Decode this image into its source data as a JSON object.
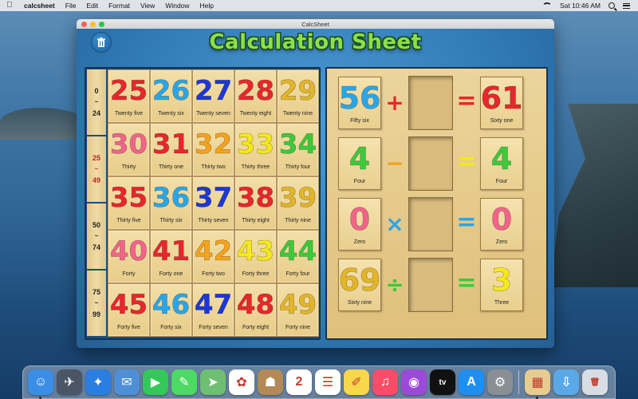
{
  "menubar": {
    "app_name": "calcsheet",
    "menus": [
      "File",
      "Edit",
      "Format",
      "View",
      "Window",
      "Help"
    ],
    "clock": "Sat 10:46 AM"
  },
  "window": {
    "title": "CalcSheet",
    "app_title": "Calculation Sheet"
  },
  "ranges": [
    {
      "from": "0",
      "tilde": "~",
      "to": "24",
      "active": false
    },
    {
      "from": "25",
      "tilde": "~",
      "to": "49",
      "active": true
    },
    {
      "from": "50",
      "tilde": "~",
      "to": "74",
      "active": false
    },
    {
      "from": "75",
      "tilde": "~",
      "to": "99",
      "active": false
    }
  ],
  "tiles": [
    {
      "num": "25",
      "word": "Twenty five",
      "color": "#e8262d"
    },
    {
      "num": "26",
      "word": "Twenty six",
      "color": "#2aa6e8"
    },
    {
      "num": "27",
      "word": "Twenty seven",
      "color": "#1d37d6"
    },
    {
      "num": "28",
      "word": "Twenty eight",
      "color": "#e8262d"
    },
    {
      "num": "29",
      "word": "Twenty nine",
      "color": "#e2b52a"
    },
    {
      "num": "30",
      "word": "Thirty",
      "color": "#f2648a"
    },
    {
      "num": "31",
      "word": "Thirty one",
      "color": "#e8262d"
    },
    {
      "num": "32",
      "word": "Thirty two",
      "color": "#f5a21c"
    },
    {
      "num": "33",
      "word": "Thirty three",
      "color": "#f5e81c"
    },
    {
      "num": "34",
      "word": "Thirty four",
      "color": "#3ec93a"
    },
    {
      "num": "35",
      "word": "Thirty five",
      "color": "#e8262d"
    },
    {
      "num": "36",
      "word": "Thirty six",
      "color": "#2aa6e8"
    },
    {
      "num": "37",
      "word": "Thirty seven",
      "color": "#1d37d6"
    },
    {
      "num": "38",
      "word": "Thirty eight",
      "color": "#e8262d"
    },
    {
      "num": "39",
      "word": "Thirty nine",
      "color": "#e2b52a"
    },
    {
      "num": "40",
      "word": "Forty",
      "color": "#f2648a"
    },
    {
      "num": "41",
      "word": "Forty one",
      "color": "#e8262d"
    },
    {
      "num": "42",
      "word": "Forty two",
      "color": "#f5a21c"
    },
    {
      "num": "43",
      "word": "Forty three",
      "color": "#f5e81c"
    },
    {
      "num": "44",
      "word": "Forty four",
      "color": "#3ec93a"
    },
    {
      "num": "45",
      "word": "Forty five",
      "color": "#e8262d"
    },
    {
      "num": "46",
      "word": "Forty six",
      "color": "#2aa6e8"
    },
    {
      "num": "47",
      "word": "Forty seven",
      "color": "#1d37d6"
    },
    {
      "num": "48",
      "word": "Forty eight",
      "color": "#e8262d"
    },
    {
      "num": "49",
      "word": "Forty nine",
      "color": "#e2b52a"
    }
  ],
  "equations": [
    {
      "left": {
        "num": "56",
        "word": "Fifty six",
        "color": "#2aa6e8"
      },
      "op": "+",
      "op_color": "#e8262d",
      "eq_color": "#e8262d",
      "result": {
        "num": "61",
        "word": "Sixty one",
        "color": "#e8262d"
      }
    },
    {
      "left": {
        "num": "4",
        "word": "Four",
        "color": "#3ec93a"
      },
      "op": "−",
      "op_color": "#f5a21c",
      "eq_color": "#f5e81c",
      "result": {
        "num": "4",
        "word": "Four",
        "color": "#3ec93a"
      }
    },
    {
      "left": {
        "num": "0",
        "word": "Zero",
        "color": "#f2648a"
      },
      "op": "×",
      "op_color": "#2aa6e8",
      "eq_color": "#2aa6e8",
      "result": {
        "num": "0",
        "word": "Zero",
        "color": "#f2648a"
      }
    },
    {
      "left": {
        "num": "69",
        "word": "Sixty nine",
        "color": "#e2b52a"
      },
      "op": "÷",
      "op_color": "#3ec93a",
      "eq_color": "#3ec93a",
      "result": {
        "num": "3",
        "word": "Three",
        "color": "#f5e81c"
      }
    }
  ],
  "dock": [
    {
      "name": "finder-icon",
      "glyph": "☺",
      "bg": "#3a8ee6",
      "running": true
    },
    {
      "name": "launchpad-icon",
      "glyph": "✈",
      "bg": "#4a5566",
      "running": false
    },
    {
      "name": "safari-icon",
      "glyph": "✦",
      "bg": "#2a7de1",
      "running": false
    },
    {
      "name": "mail-icon",
      "glyph": "✉",
      "bg": "#4f8fd6",
      "running": false
    },
    {
      "name": "facetime-icon",
      "glyph": "▶",
      "bg": "#34c759",
      "running": false
    },
    {
      "name": "messages-icon",
      "glyph": "✎",
      "bg": "#4cd964",
      "running": false
    },
    {
      "name": "maps-icon",
      "glyph": "➤",
      "bg": "#6fbf73",
      "running": false
    },
    {
      "name": "photos-icon",
      "glyph": "✿",
      "bg": "#ffffff",
      "running": false
    },
    {
      "name": "contacts-icon",
      "glyph": "☗",
      "bg": "#b38a55",
      "running": false
    },
    {
      "name": "calendar-icon",
      "glyph": "2",
      "bg": "#ffffff",
      "running": false
    },
    {
      "name": "reminders-icon",
      "glyph": "☰",
      "bg": "#ffffff",
      "running": false
    },
    {
      "name": "notes-icon",
      "glyph": "✐",
      "bg": "#f8d84b",
      "running": false
    },
    {
      "name": "music-icon",
      "glyph": "♫",
      "bg": "#f94c68",
      "running": false
    },
    {
      "name": "podcasts-icon",
      "glyph": "◉",
      "bg": "#9b4ad8",
      "running": false
    },
    {
      "name": "tv-icon",
      "glyph": "tv",
      "bg": "#111111",
      "running": false
    },
    {
      "name": "app-store-icon",
      "glyph": "A",
      "bg": "#1f8ef1",
      "running": false
    },
    {
      "name": "system-preferences-icon",
      "glyph": "⚙",
      "bg": "#8a8f96",
      "running": false
    },
    {
      "name": "calcsheet-app-icon",
      "glyph": "▦",
      "bg": "#e7cc8f",
      "running": true
    },
    {
      "name": "downloads-folder-icon",
      "glyph": "⇩",
      "bg": "#5aa9e6",
      "running": false
    },
    {
      "name": "trash-icon",
      "glyph": "🗑",
      "bg": "#d8dde3",
      "running": false
    }
  ]
}
